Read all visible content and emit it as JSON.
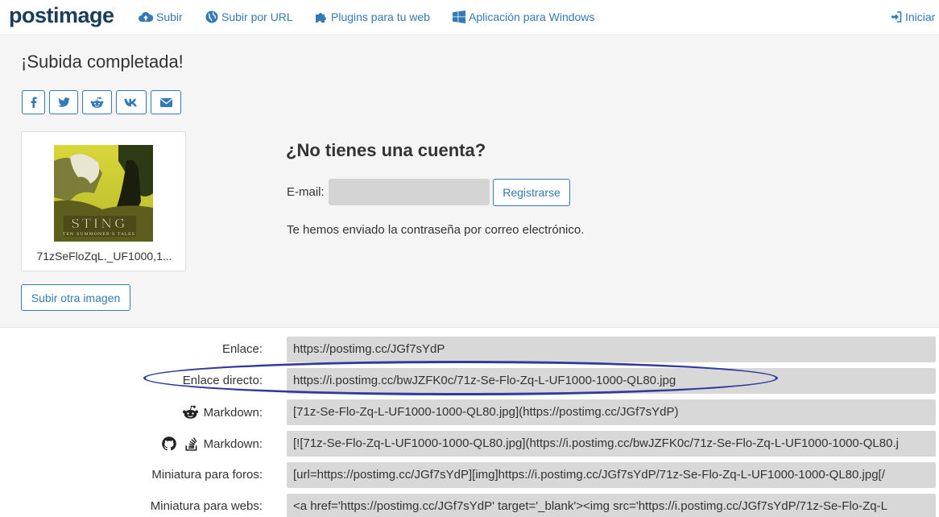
{
  "navbar": {
    "logo_pre": "post",
    "logo_post": "image",
    "items": [
      {
        "label": "Subir",
        "icon": "cloud-upload-icon"
      },
      {
        "label": "Subir por URL",
        "icon": "globe-icon"
      },
      {
        "label": "Plugins para tu web",
        "icon": "puzzle-icon"
      },
      {
        "label": "Aplicación para Windows",
        "icon": "windows-icon"
      }
    ],
    "login_label": "Iniciar"
  },
  "upload": {
    "title": "¡Subida completada!",
    "share_icons": [
      "facebook-icon",
      "twitter-icon",
      "reddit-icon",
      "vk-icon",
      "envelope-icon"
    ],
    "thumb_filename": "71zSeFloZqL._UF1000,1...",
    "thumb_text": "STING",
    "thumb_subtext": "TEN SUMMONER'S TALES",
    "upload_other_label": "Subir otra imagen"
  },
  "account": {
    "title": "¿No tienes una cuenta?",
    "email_label": "E-mail:",
    "email_value": "",
    "register_label": "Registrarse",
    "sent_message": "Te hemos enviado la contraseña por correo electrónico."
  },
  "links": [
    {
      "label": "Enlace:",
      "value": "https://postimg.cc/JGf7sYdP"
    },
    {
      "label": "Enlace directo:",
      "value": "https://i.postimg.cc/bwJZFK0c/71z-Se-Flo-Zq-L-UF1000-1000-QL80.jpg"
    },
    {
      "label": "Markdown:",
      "value": "[71z-Se-Flo-Zq-L-UF1000-1000-QL80.jpg](https://postimg.cc/JGf7sYdP)"
    },
    {
      "label": "Markdown:",
      "value": "[![71z-Se-Flo-Zq-L-UF1000-1000-QL80.jpg](https://i.postimg.cc/bwJZFK0c/71z-Se-Flo-Zq-L-UF1000-1000-QL80.j"
    },
    {
      "label": "Miniatura para foros:",
      "value": "[url=https://postimg.cc/JGf7sYdP][img]https://i.postimg.cc/JGf7sYdP/71z-Se-Flo-Zq-L-UF1000-1000-QL80.jpg[/"
    },
    {
      "label": "Miniatura para webs:",
      "value": "<a href='https://postimg.cc/JGf7sYdP' target='_blank'><img src='https://i.postimg.cc/JGf7sYdP/71z-Se-Flo-Zq-L"
    }
  ],
  "colors": {
    "accent": "#337ab7",
    "logo": "#1b3d5c",
    "highlight": "#2e3a9e",
    "field_bg": "#d8d8d8",
    "section_bg": "#f5f5f5"
  }
}
